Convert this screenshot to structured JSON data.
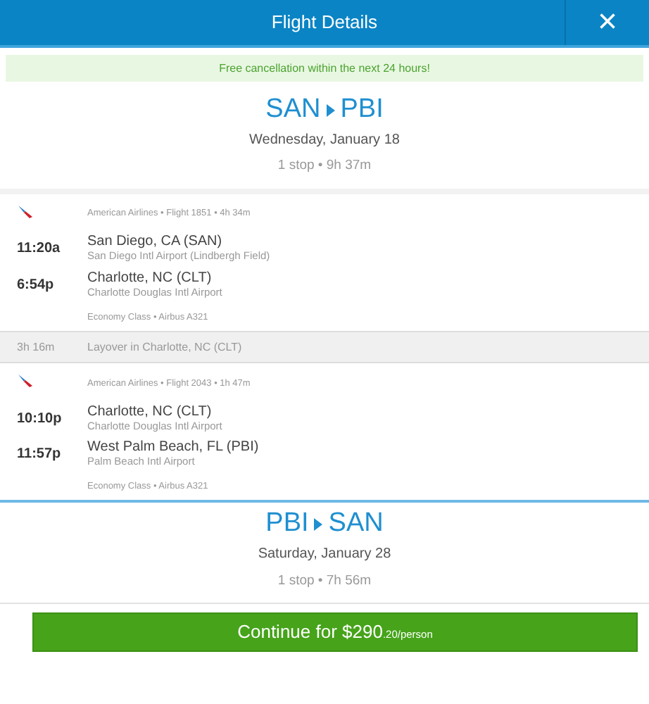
{
  "header": {
    "title": "Flight Details",
    "close": "×"
  },
  "notice": "Free cancellation within the next 24 hours!",
  "trips": [
    {
      "origin": "SAN",
      "destination": "PBI",
      "date": "Wednesday, January 18",
      "summary": "1 stop • 9h 37m",
      "segments": [
        {
          "kind": "flight",
          "info": "American Airlines • Flight 1851 • 4h 34m",
          "stops": [
            {
              "time": "11:20a",
              "city": "San Diego, CA (SAN)",
              "airport": "San Diego Intl Airport (Lindbergh Field)"
            },
            {
              "time": "6:54p",
              "city": "Charlotte, NC (CLT)",
              "airport": "Charlotte Douglas Intl Airport"
            }
          ],
          "cabin": "Economy Class • Airbus A321"
        },
        {
          "kind": "layover",
          "duration": "3h 16m",
          "text": "Layover in Charlotte, NC (CLT)"
        },
        {
          "kind": "flight",
          "info": "American Airlines • Flight 2043 • 1h 47m",
          "stops": [
            {
              "time": "10:10p",
              "city": "Charlotte, NC (CLT)",
              "airport": "Charlotte Douglas Intl Airport"
            },
            {
              "time": "11:57p",
              "city": "West Palm Beach, FL (PBI)",
              "airport": "Palm Beach Intl Airport"
            }
          ],
          "cabin": "Economy Class • Airbus A321"
        }
      ]
    },
    {
      "origin": "PBI",
      "destination": "SAN",
      "date": "Saturday, January 28",
      "summary": "1 stop • 7h 56m"
    }
  ],
  "continue_button": {
    "label": "Continue for $290",
    "suffix": ".20/person"
  }
}
